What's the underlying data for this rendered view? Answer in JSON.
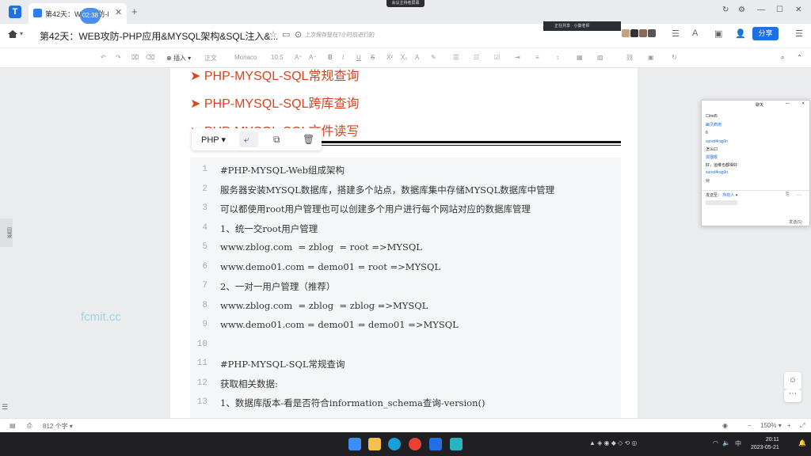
{
  "tabbar": {
    "tab_title": "第42天：WEB攻防-PHP应用&MYSQL架构...",
    "timer": "02:38",
    "new_tab": "+",
    "recording_badge": "会议主持者屏幕"
  },
  "docbar": {
    "title": "第42天：WEB攻防-PHP应用&MYSQL架构&SQL注入&...",
    "saved_status": "上次保存是在7小时前进行的",
    "meeting_strip": "正在共享 · 小葵老师",
    "share_label": "分享"
  },
  "toolbar": {
    "insert": "插入",
    "style": "正文",
    "font": "Monaco",
    "size": "10.5"
  },
  "doc": {
    "headings": [
      "PHP-MYSQL-SQL常规查询",
      "PHP-MYSQL-SQL跨库查询",
      "PHP-MYSQL-SQL文件读写"
    ],
    "code_language": "PHP",
    "lines": [
      {
        "n": "1",
        "text": "#PHP-MYSQL-Web组成架构"
      },
      {
        "n": "2",
        "text": "服务器安装MYSQL数据库，搭建多个站点，数据库集中存储MYSQL数据库中管理"
      },
      {
        "n": "3",
        "text": "可以都使用root用户管理也可以创建多个用户进行每个网站对应的数据库管理"
      },
      {
        "n": "4",
        "text": "1、统一交root用户管理"
      },
      {
        "n": "5",
        "text": "www.zblog.com  = zblog  = root =>MYSQL"
      },
      {
        "n": "6",
        "text": "www.demo01.com = demo01 = root =>MYSQL"
      },
      {
        "n": "7",
        "text": "2、一对一用户管理（推荐）"
      },
      {
        "n": "8",
        "text": "www.zblog.com  = zblog  = zblog =>MYSQL"
      },
      {
        "n": "9",
        "text": "www.demo01.com = demo01 = demo01 =>MYSQL"
      },
      {
        "n": "10",
        "text": ""
      },
      {
        "n": "11",
        "text": "#PHP-MYSQL-SQL常规查询"
      },
      {
        "n": "12",
        "text": "获取相关数据:"
      },
      {
        "n": "13",
        "text": "1、数据库版本-看是否符合information_schema查询-version()"
      }
    ]
  },
  "watermark": "fcmit.cc",
  "side_tab": "目录",
  "chat": {
    "title": "聊天",
    "messages": [
      {
        "text": "口md5",
        "color": "blk"
      },
      {
        "text": "幽灵疯雨",
        "color": "blue"
      },
      {
        "text": "6",
        "color": "blk"
      },
      {
        "text": "sured4rag0n",
        "color": "blue"
      },
      {
        "text": "怎么口",
        "color": "blk"
      },
      {
        "text": "狐狸眼",
        "color": "blue"
      },
      {
        "text": "好，运维也都得好",
        "color": "blk"
      },
      {
        "text": "sured4rag0n",
        "color": "blue"
      },
      {
        "text": "对",
        "color": "blk"
      }
    ],
    "send_to": "发送至：",
    "send_to_value": "所有人",
    "send_button": "发送(S)"
  },
  "statusbar": {
    "word_count": "812 个字",
    "zoom": "150%"
  },
  "clock": {
    "time": "20:11",
    "date": "2023-05-21"
  },
  "colors": {
    "accent": "#1f6fe5",
    "heading_red": "#e0401c",
    "watermark": "#6fd0e6"
  }
}
